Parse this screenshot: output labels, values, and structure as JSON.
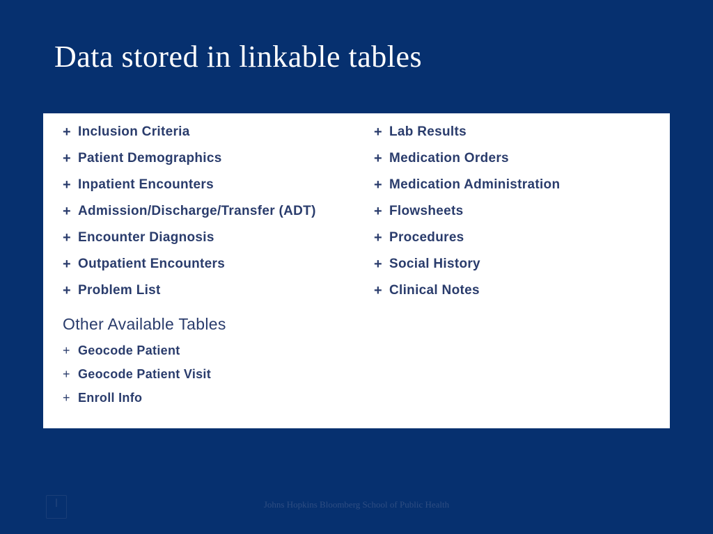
{
  "title": "Data stored in linkable tables",
  "left_items": [
    "Inclusion Criteria",
    "Patient Demographics",
    "Inpatient Encounters",
    "Admission/Discharge/Transfer (ADT)",
    "Encounter Diagnosis",
    "Outpatient Encounters",
    "Problem List"
  ],
  "right_items": [
    "Lab Results",
    "Medication Orders",
    "Medication Administration",
    "Flowsheets",
    "Procedures",
    "Social History",
    "Clinical Notes"
  ],
  "subheading": "Other Available Tables",
  "other_items": [
    "Geocode Patient",
    "Geocode Patient Visit",
    "Enroll Info"
  ],
  "footer": "Johns Hopkins Bloomberg School of Public Health"
}
